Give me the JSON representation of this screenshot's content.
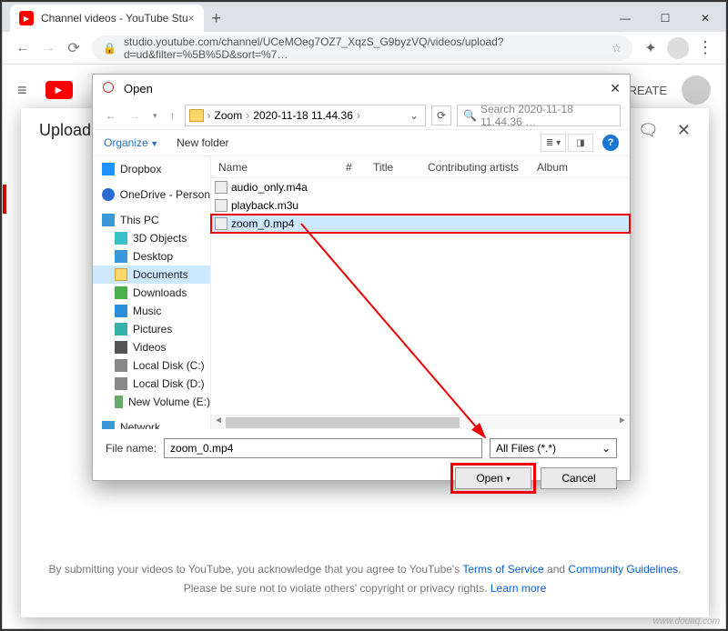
{
  "browser": {
    "tab_title": "Channel videos - YouTube Stu",
    "url": "studio.youtube.com/channel/UCeMOeg7OZ7_XqzS_G9byzVQ/videos/upload?d=ud&filter=%5B%5D&sort=%7…"
  },
  "yt": {
    "create_label": "CREATE",
    "upload_title": "Upload v"
  },
  "tos": {
    "pre": "By submitting your videos to YouTube, you acknowledge that you agree to YouTube's ",
    "link1": "Terms of Service",
    "mid": " and ",
    "link2": "Community Guidelines",
    "line2_pre": "Please be sure not to violate others' copyright or privacy rights. ",
    "link3": "Learn more"
  },
  "dialog": {
    "title": "Open",
    "breadcrumb": [
      "Zoom",
      "2020-11-18 11.44.36"
    ],
    "search_placeholder": "Search 2020-11-18 11.44.36 …",
    "organize": "Organize",
    "new_folder": "New folder",
    "columns": {
      "name": "Name",
      "num": "#",
      "title": "Title",
      "artists": "Contributing artists",
      "album": "Album"
    },
    "files": [
      {
        "name": "audio_only.m4a",
        "selected": false
      },
      {
        "name": "playback.m3u",
        "selected": false
      },
      {
        "name": "zoom_0.mp4",
        "selected": true
      }
    ],
    "filename_label": "File name:",
    "filename_value": "zoom_0.mp4",
    "filetype_value": "All Files (*.*)",
    "open_btn": "Open",
    "cancel_btn": "Cancel"
  },
  "tree": {
    "dropbox": "Dropbox",
    "onedrive": "OneDrive - Person",
    "thispc": "This PC",
    "objects3d": "3D Objects",
    "desktop": "Desktop",
    "documents": "Documents",
    "downloads": "Downloads",
    "music": "Music",
    "pictures": "Pictures",
    "videos": "Videos",
    "ldc": "Local Disk (C:)",
    "ldd": "Local Disk (D:)",
    "nve": "New Volume (E:)",
    "network": "Network"
  },
  "watermark": "www.douaq.com"
}
